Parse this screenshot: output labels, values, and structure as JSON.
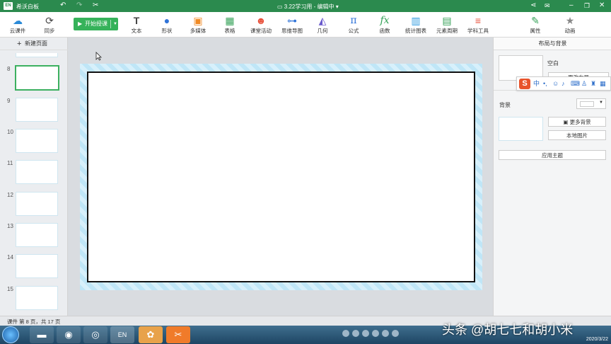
{
  "titlebar": {
    "app_logo": "EN",
    "app_name": "希沃白板",
    "doc_title": "3.22学习用 - 编辑中",
    "undo_icon": "undo-icon",
    "redo_icon": "redo-icon",
    "cut_icon": "scissors-icon"
  },
  "toolbar": {
    "cloud": "云课件",
    "sync": "同步",
    "start_lesson": "开始授课",
    "tools": [
      {
        "label": "文本",
        "icon": "T"
      },
      {
        "label": "形状",
        "icon": "●"
      },
      {
        "label": "多媒体",
        "icon": "▣"
      },
      {
        "label": "表格",
        "icon": "▦"
      },
      {
        "label": "课堂活动",
        "icon": "☻"
      },
      {
        "label": "思维导图",
        "icon": "⊶"
      },
      {
        "label": "几何",
        "icon": "◭"
      },
      {
        "label": "公式",
        "icon": "π"
      },
      {
        "label": "函数",
        "icon": "fx"
      },
      {
        "label": "统计图表",
        "icon": "▥"
      },
      {
        "label": "元素周期",
        "icon": "▤"
      },
      {
        "label": "学科工具",
        "icon": "≡"
      },
      {
        "label": "属性",
        "icon": "✎"
      },
      {
        "label": "动画",
        "icon": "★"
      }
    ]
  },
  "left_panel": {
    "new_page": "新建页面",
    "slides": [
      {
        "num": "8",
        "active": true
      },
      {
        "num": "9",
        "active": false
      },
      {
        "num": "10",
        "active": false
      },
      {
        "num": "11",
        "active": false
      },
      {
        "num": "12",
        "active": false
      },
      {
        "num": "13",
        "active": false
      },
      {
        "num": "14",
        "active": false
      },
      {
        "num": "15",
        "active": false
      }
    ]
  },
  "right_panel": {
    "title": "布局与背景",
    "blank": "空白",
    "change_layout": "更改布局",
    "background": "背景",
    "more_backgrounds": "更多背景",
    "local_image": "本地图片",
    "apply_theme": "应用主题"
  },
  "ime": {
    "logo": "S",
    "lang": "中"
  },
  "status": {
    "text": "课件 第 8 页，共 17 页"
  },
  "taskbar": {
    "date": "2020/3/22"
  },
  "watermark": "头条 @胡七七和胡小米",
  "colors": {
    "titlebar": "#2b8a4e",
    "start_button": "#35b25a",
    "slide_border": "#111111",
    "slide_frame": "#bfe6f7"
  }
}
